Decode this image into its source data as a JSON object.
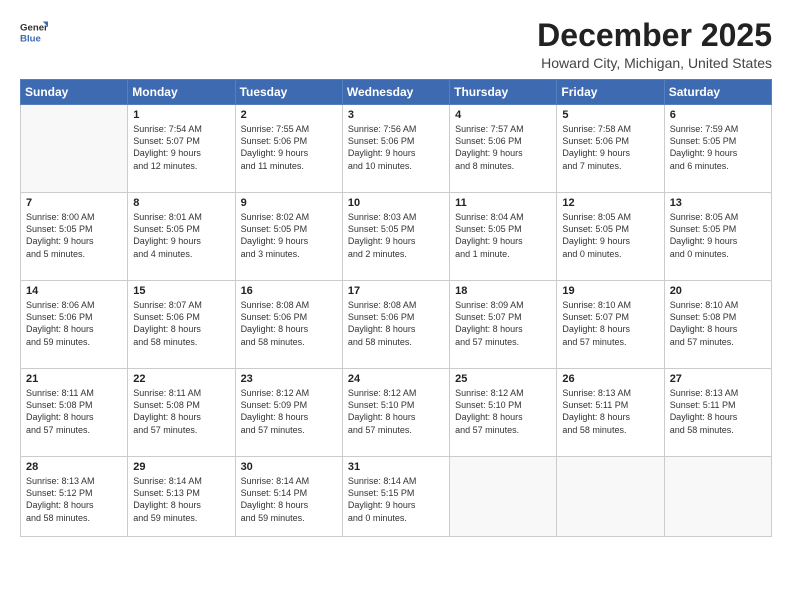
{
  "header": {
    "logo_line1": "General",
    "logo_line2": "Blue",
    "month": "December 2025",
    "location": "Howard City, Michigan, United States"
  },
  "days_of_week": [
    "Sunday",
    "Monday",
    "Tuesday",
    "Wednesday",
    "Thursday",
    "Friday",
    "Saturday"
  ],
  "weeks": [
    [
      {
        "num": "",
        "content": ""
      },
      {
        "num": "1",
        "content": "Sunrise: 7:54 AM\nSunset: 5:07 PM\nDaylight: 9 hours\nand 12 minutes."
      },
      {
        "num": "2",
        "content": "Sunrise: 7:55 AM\nSunset: 5:06 PM\nDaylight: 9 hours\nand 11 minutes."
      },
      {
        "num": "3",
        "content": "Sunrise: 7:56 AM\nSunset: 5:06 PM\nDaylight: 9 hours\nand 10 minutes."
      },
      {
        "num": "4",
        "content": "Sunrise: 7:57 AM\nSunset: 5:06 PM\nDaylight: 9 hours\nand 8 minutes."
      },
      {
        "num": "5",
        "content": "Sunrise: 7:58 AM\nSunset: 5:06 PM\nDaylight: 9 hours\nand 7 minutes."
      },
      {
        "num": "6",
        "content": "Sunrise: 7:59 AM\nSunset: 5:05 PM\nDaylight: 9 hours\nand 6 minutes."
      }
    ],
    [
      {
        "num": "7",
        "content": "Sunrise: 8:00 AM\nSunset: 5:05 PM\nDaylight: 9 hours\nand 5 minutes."
      },
      {
        "num": "8",
        "content": "Sunrise: 8:01 AM\nSunset: 5:05 PM\nDaylight: 9 hours\nand 4 minutes."
      },
      {
        "num": "9",
        "content": "Sunrise: 8:02 AM\nSunset: 5:05 PM\nDaylight: 9 hours\nand 3 minutes."
      },
      {
        "num": "10",
        "content": "Sunrise: 8:03 AM\nSunset: 5:05 PM\nDaylight: 9 hours\nand 2 minutes."
      },
      {
        "num": "11",
        "content": "Sunrise: 8:04 AM\nSunset: 5:05 PM\nDaylight: 9 hours\nand 1 minute."
      },
      {
        "num": "12",
        "content": "Sunrise: 8:05 AM\nSunset: 5:05 PM\nDaylight: 9 hours\nand 0 minutes."
      },
      {
        "num": "13",
        "content": "Sunrise: 8:05 AM\nSunset: 5:05 PM\nDaylight: 9 hours\nand 0 minutes."
      }
    ],
    [
      {
        "num": "14",
        "content": "Sunrise: 8:06 AM\nSunset: 5:06 PM\nDaylight: 8 hours\nand 59 minutes."
      },
      {
        "num": "15",
        "content": "Sunrise: 8:07 AM\nSunset: 5:06 PM\nDaylight: 8 hours\nand 58 minutes."
      },
      {
        "num": "16",
        "content": "Sunrise: 8:08 AM\nSunset: 5:06 PM\nDaylight: 8 hours\nand 58 minutes."
      },
      {
        "num": "17",
        "content": "Sunrise: 8:08 AM\nSunset: 5:06 PM\nDaylight: 8 hours\nand 58 minutes."
      },
      {
        "num": "18",
        "content": "Sunrise: 8:09 AM\nSunset: 5:07 PM\nDaylight: 8 hours\nand 57 minutes."
      },
      {
        "num": "19",
        "content": "Sunrise: 8:10 AM\nSunset: 5:07 PM\nDaylight: 8 hours\nand 57 minutes."
      },
      {
        "num": "20",
        "content": "Sunrise: 8:10 AM\nSunset: 5:08 PM\nDaylight: 8 hours\nand 57 minutes."
      }
    ],
    [
      {
        "num": "21",
        "content": "Sunrise: 8:11 AM\nSunset: 5:08 PM\nDaylight: 8 hours\nand 57 minutes."
      },
      {
        "num": "22",
        "content": "Sunrise: 8:11 AM\nSunset: 5:08 PM\nDaylight: 8 hours\nand 57 minutes."
      },
      {
        "num": "23",
        "content": "Sunrise: 8:12 AM\nSunset: 5:09 PM\nDaylight: 8 hours\nand 57 minutes."
      },
      {
        "num": "24",
        "content": "Sunrise: 8:12 AM\nSunset: 5:10 PM\nDaylight: 8 hours\nand 57 minutes."
      },
      {
        "num": "25",
        "content": "Sunrise: 8:12 AM\nSunset: 5:10 PM\nDaylight: 8 hours\nand 57 minutes."
      },
      {
        "num": "26",
        "content": "Sunrise: 8:13 AM\nSunset: 5:11 PM\nDaylight: 8 hours\nand 58 minutes."
      },
      {
        "num": "27",
        "content": "Sunrise: 8:13 AM\nSunset: 5:11 PM\nDaylight: 8 hours\nand 58 minutes."
      }
    ],
    [
      {
        "num": "28",
        "content": "Sunrise: 8:13 AM\nSunset: 5:12 PM\nDaylight: 8 hours\nand 58 minutes."
      },
      {
        "num": "29",
        "content": "Sunrise: 8:14 AM\nSunset: 5:13 PM\nDaylight: 8 hours\nand 59 minutes."
      },
      {
        "num": "30",
        "content": "Sunrise: 8:14 AM\nSunset: 5:14 PM\nDaylight: 8 hours\nand 59 minutes."
      },
      {
        "num": "31",
        "content": "Sunrise: 8:14 AM\nSunset: 5:15 PM\nDaylight: 9 hours\nand 0 minutes."
      },
      {
        "num": "",
        "content": ""
      },
      {
        "num": "",
        "content": ""
      },
      {
        "num": "",
        "content": ""
      }
    ]
  ]
}
